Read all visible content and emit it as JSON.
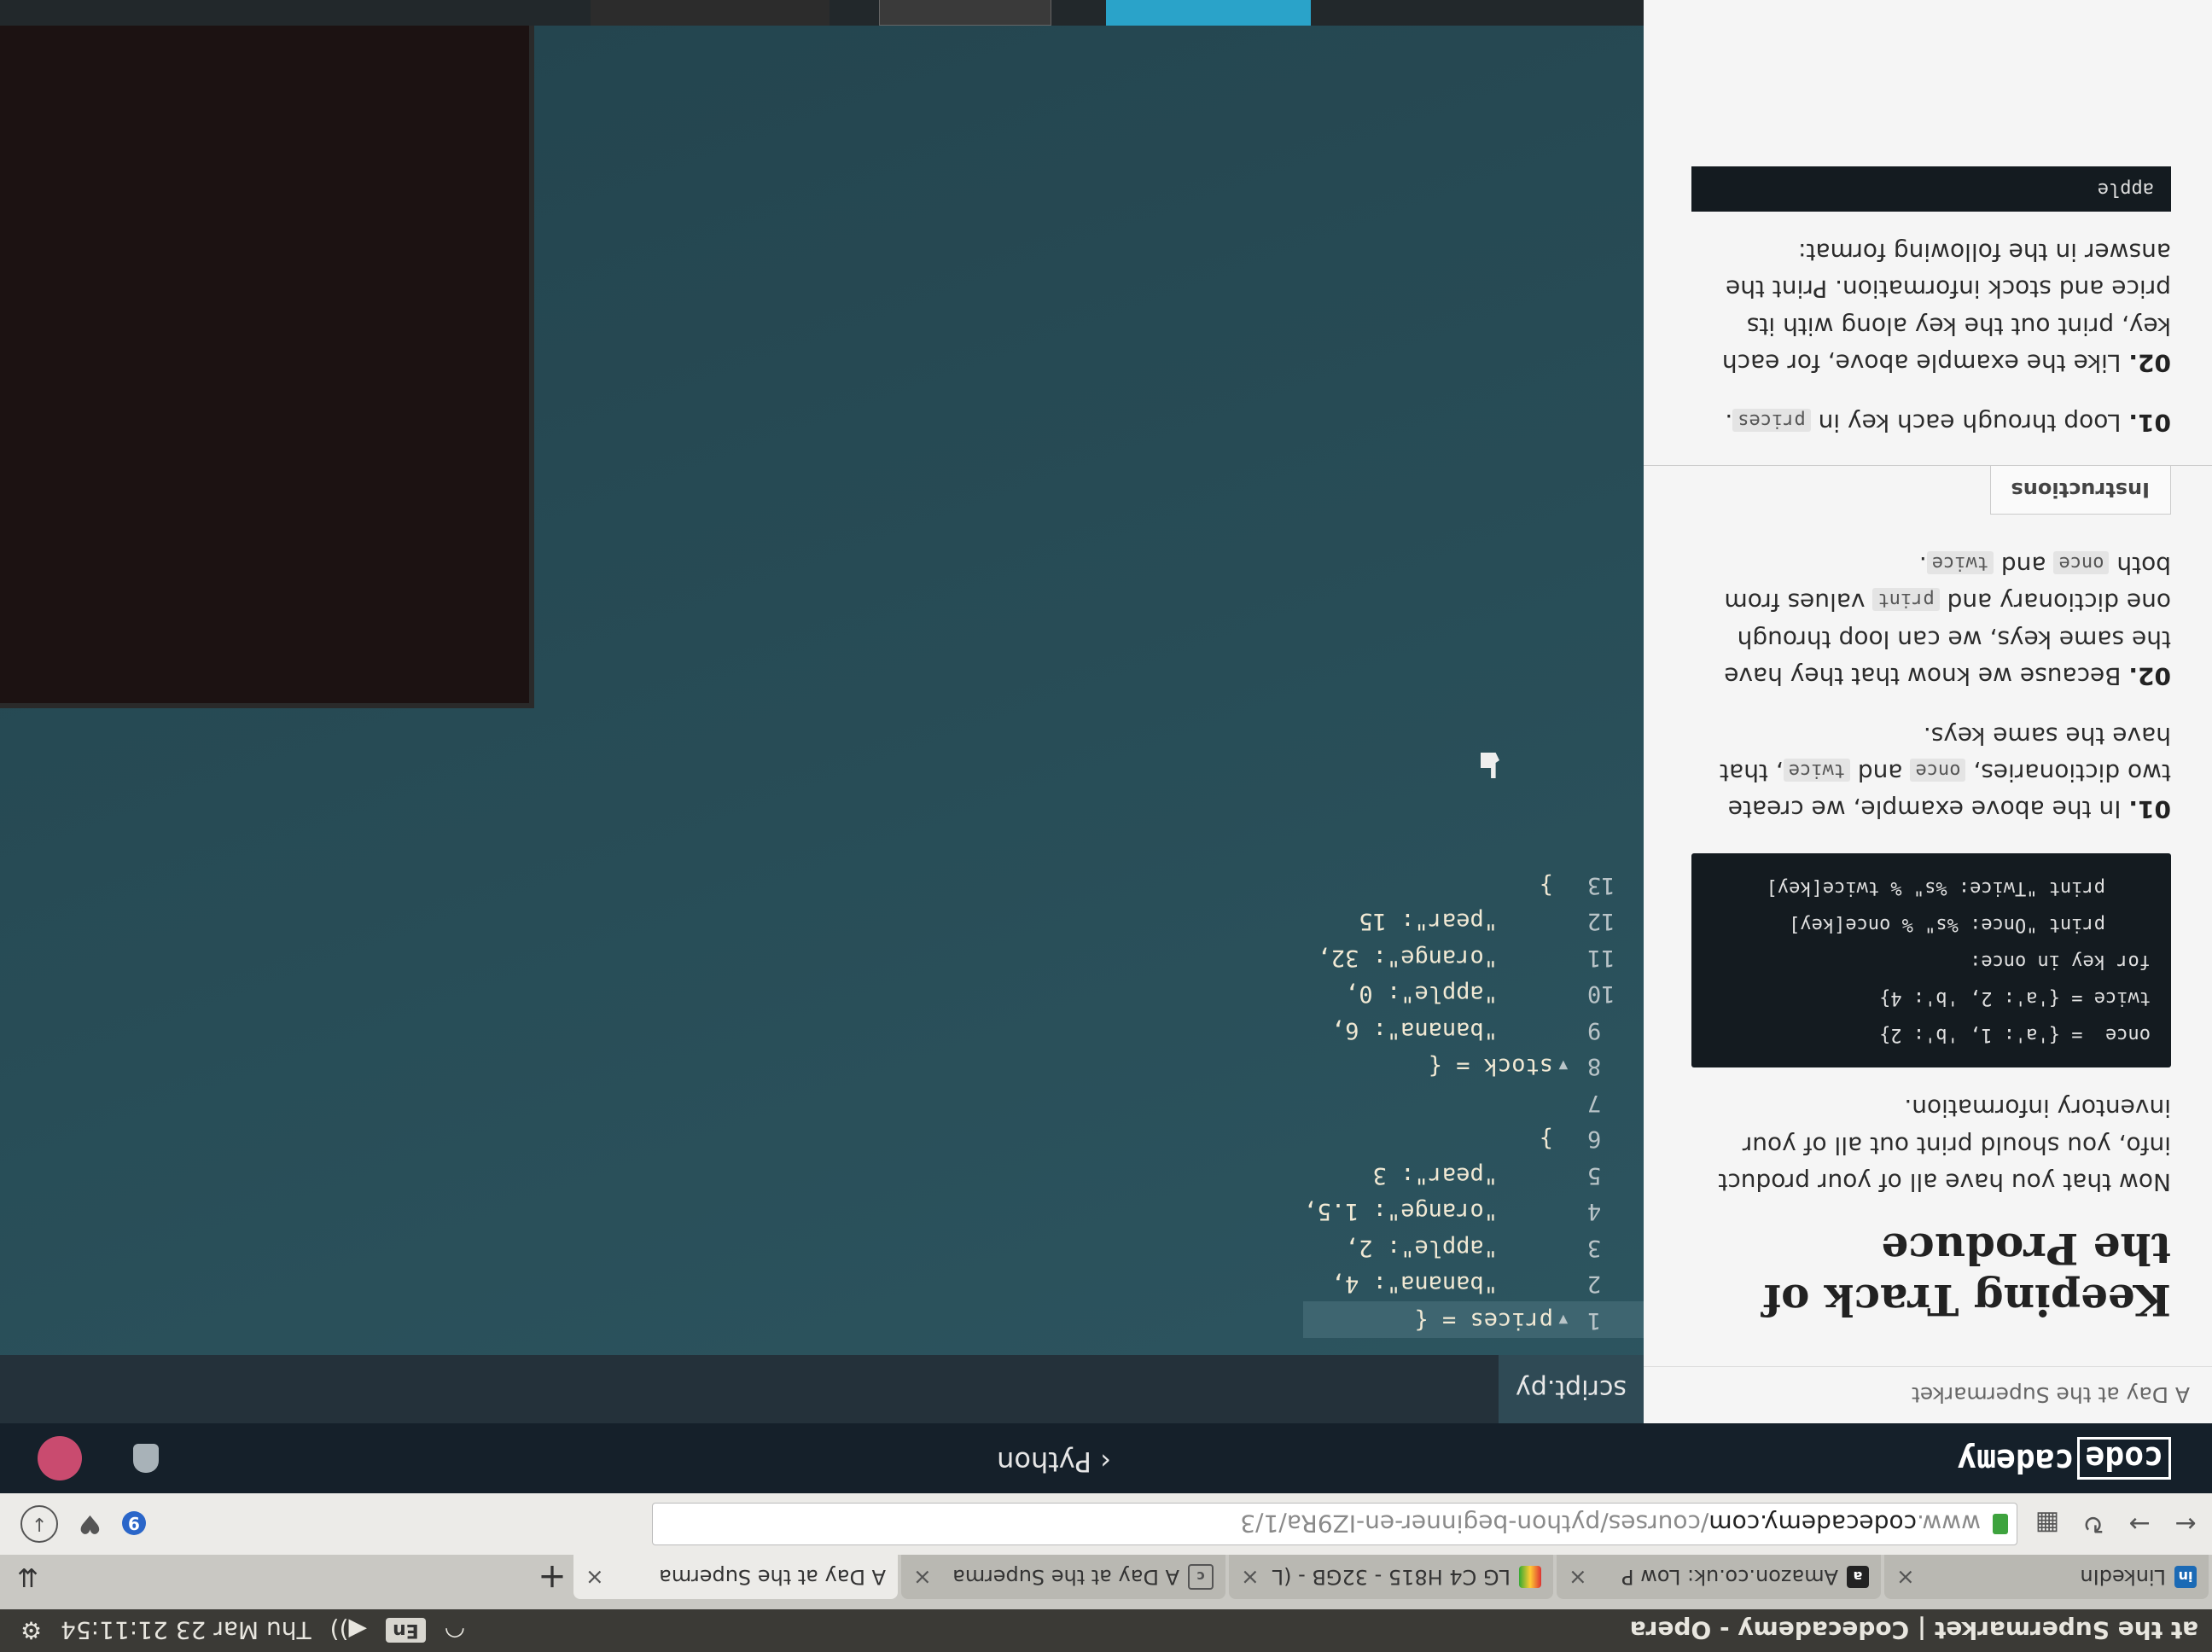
{
  "os": {
    "window_title": "at the Supermarket | Codecademy - Opera",
    "keyboard": "En",
    "clock": "Thu Mar 23 21:11:54"
  },
  "tabs": [
    {
      "label": "A Day at the Superma",
      "active": true,
      "icon_text": ""
    },
    {
      "label": "A Day at the Superma",
      "active": false,
      "icon_text": ""
    },
    {
      "label": "LG C4 H815 - 32GB - (L",
      "active": false,
      "icon_text": ""
    },
    {
      "label": "Amazon.co.uk: Low P",
      "active": false,
      "icon_text": "a"
    },
    {
      "label": "LinkedIn",
      "active": false,
      "icon_text": "in"
    }
  ],
  "address": {
    "prefix": "www.",
    "domain": "codecademy.com",
    "path": "/courses/python-beginner-en-IZ9Ra/1/3",
    "badge_count": "9"
  },
  "header": {
    "logo_left": "code",
    "logo_right": "cademy",
    "course": "Python"
  },
  "lesson": {
    "breadcrumb": "A Day at the Supermarket",
    "title": "Keeping Track of the Produce",
    "intro": "Now that you have all of your product info, you should print out all of your inventory information.",
    "example_code": [
      "once  = {'a': 1, 'b': 2}",
      "twice = {'a': 2, 'b': 4}",
      "for key in once:",
      "    print \"Once: %s\" % once[key]",
      "    print \"Twice: %s\" % twice[key]"
    ],
    "p1_num": "01.",
    "p1_a": "In the above example, we create two dictionaries,",
    "p1_code1": "once",
    "p1_and": "and",
    "p1_code2": "twice",
    "p1_b": ", that have the same keys.",
    "p2_num": "02.",
    "p2_a": "Because we know that they have the same keys, we can loop through one dictionary and",
    "p2_code1": "print",
    "p2_b": "values from both",
    "p2_code2": "once",
    "p2_and": "and",
    "p2_code3": "twice",
    "p2_c": ".",
    "instructions_tab": "Instructions",
    "i1_num": "01.",
    "i1_a": "Loop through each key in",
    "i1_code": "prices",
    "i1_b": ".",
    "i2_num": "02.",
    "i2_text": "Like the example above, for each key, print out the key along with its price and stock information. Print the answer in the following format:",
    "hint": "apple"
  },
  "editor": {
    "file_tab": "script.py",
    "lines": [
      {
        "n": "1",
        "fold": "▾",
        "code": "prices = {"
      },
      {
        "n": "2",
        "fold": "",
        "code": "    \"banana\": 4,"
      },
      {
        "n": "3",
        "fold": "",
        "code": "    \"apple\": 2,"
      },
      {
        "n": "4",
        "fold": "",
        "code": "    \"orange\": 1.5,"
      },
      {
        "n": "5",
        "fold": "",
        "code": "    \"pear\": 3"
      },
      {
        "n": "6",
        "fold": "",
        "code": "}"
      },
      {
        "n": "7",
        "fold": "",
        "code": ""
      },
      {
        "n": "8",
        "fold": "▾",
        "code": "stock = {"
      },
      {
        "n": "9",
        "fold": "",
        "code": "    \"banana\": 6,"
      },
      {
        "n": "10",
        "fold": "",
        "code": "    \"apple\": 0,"
      },
      {
        "n": "11",
        "fold": "",
        "code": "    \"orange\": 32,"
      },
      {
        "n": "12",
        "fold": "",
        "code": "    \"pear\": 15"
      },
      {
        "n": "13",
        "fold": "",
        "code": "}"
      }
    ]
  },
  "colors": {
    "editor_bg": "#2b525d",
    "header_bg": "#15202a",
    "run_button": "#2aa3c9"
  }
}
